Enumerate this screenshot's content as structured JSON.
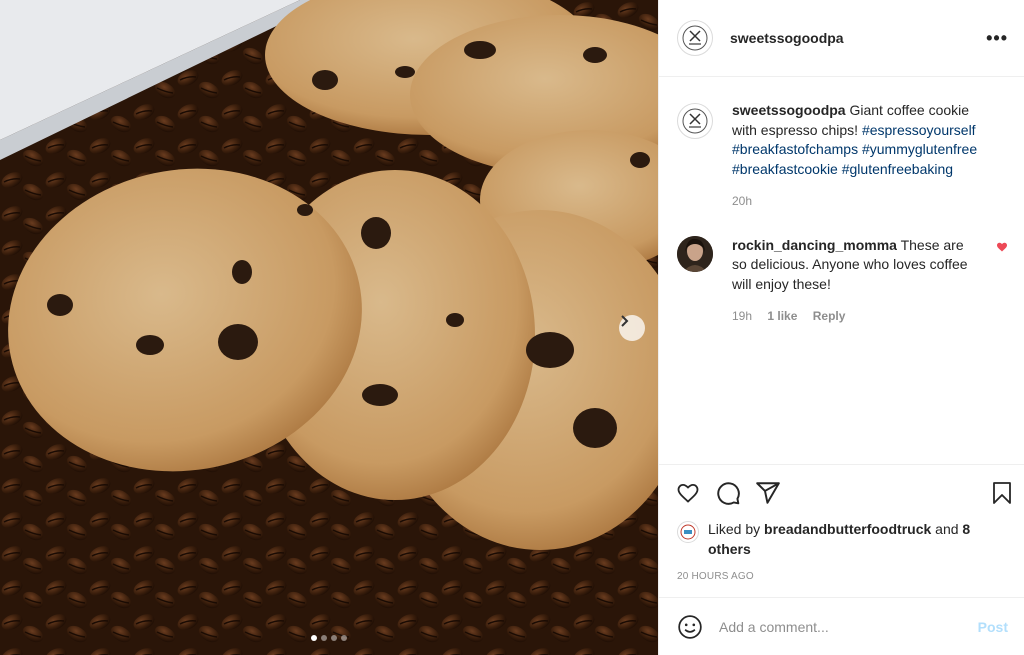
{
  "post": {
    "username": "sweetssogoodpa",
    "more_icon": "more-horizontal-icon",
    "caption": {
      "username": "sweetssogoodpa",
      "text": "Giant coffee cookie with espresso chips!",
      "hashtags": [
        "#espressoyourself",
        "#breakfastofchamps",
        "#yummyglutenfree",
        "#breakfastcookie",
        "#glutenfreebaking"
      ],
      "age": "20h"
    },
    "comments": [
      {
        "username": "rockin_dancing_momma",
        "text": "These are so delicious. Anyone who loves coffee will enjoy these!",
        "age": "19h",
        "likes": "1 like",
        "reply": "Reply",
        "liked": true
      }
    ],
    "liked_by": {
      "prefix": "Liked by",
      "user": "breadandbutterfoodtruck",
      "and": "and",
      "others": "8 others"
    },
    "timestamp": "20 HOURS AGO",
    "add_comment": {
      "placeholder": "Add a comment...",
      "post_label": "Post"
    },
    "carousel": {
      "current": 1,
      "total": 4
    }
  },
  "colors": {
    "hashtag": "#00376b",
    "heart": "#ed4956",
    "muted": "#8e8e8e",
    "post_disabled": "#b2dffc"
  }
}
